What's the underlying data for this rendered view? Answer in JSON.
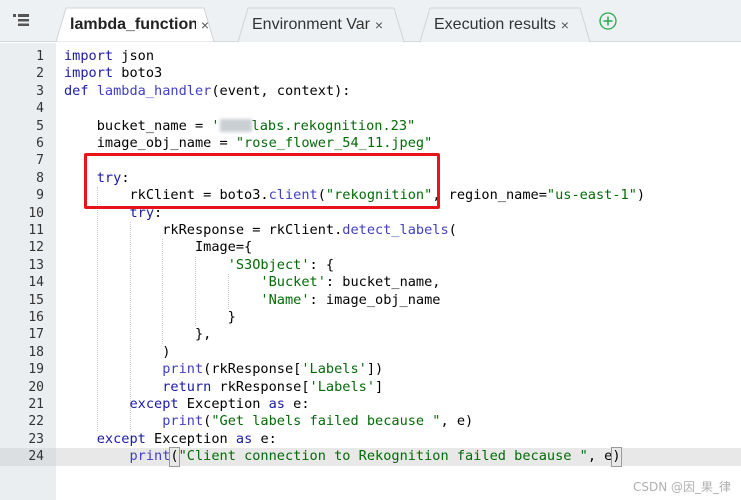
{
  "tabs": [
    {
      "label": "lambda_function",
      "close": "×",
      "active": true
    },
    {
      "label": "Environment Var",
      "close": "×",
      "active": false
    },
    {
      "label": "Execution results",
      "close": "×",
      "active": false
    }
  ],
  "icons": {
    "menu": "menu-icon",
    "add_tab": "plus-circle-icon",
    "accent": "#2aa84a",
    "highlight": "#e8141b"
  },
  "editor": {
    "line_numbers": [
      "1",
      "2",
      "3",
      "4",
      "5",
      "6",
      "7",
      "8",
      "9",
      "10",
      "11",
      "12",
      "13",
      "14",
      "15",
      "16",
      "17",
      "18",
      "19",
      "20",
      "21",
      "22",
      "23",
      "24"
    ],
    "current_line": 24,
    "lines": [
      [
        {
          "t": "import",
          "c": "kw"
        },
        {
          "t": " json",
          "c": "plain"
        }
      ],
      [
        {
          "t": "import",
          "c": "kw"
        },
        {
          "t": " boto3",
          "c": "plain"
        }
      ],
      [
        {
          "t": "def",
          "c": "kw"
        },
        {
          "t": " ",
          "c": "plain"
        },
        {
          "t": "lambda_handler",
          "c": "fn"
        },
        {
          "t": "(event, context):",
          "c": "plain"
        }
      ],
      [],
      [
        {
          "t": "    bucket_name = ",
          "c": "plain"
        },
        {
          "t": "'",
          "c": "str"
        },
        {
          "t": "",
          "c": "blur"
        },
        {
          "t": "labs.rekognition.23\"",
          "c": "str"
        }
      ],
      [
        {
          "t": "    image_obj_name = ",
          "c": "plain"
        },
        {
          "t": "\"rose_flower_54_11.jpeg\"",
          "c": "str"
        }
      ],
      [],
      [
        {
          "t": "    ",
          "c": "plain"
        },
        {
          "t": "try",
          "c": "kw"
        },
        {
          "t": ":",
          "c": "plain"
        }
      ],
      [
        {
          "t": "        rkClient = boto3.",
          "c": "plain"
        },
        {
          "t": "client",
          "c": "fn"
        },
        {
          "t": "(",
          "c": "plain"
        },
        {
          "t": "\"rekognition\"",
          "c": "str"
        },
        {
          "t": ", region_name=",
          "c": "plain"
        },
        {
          "t": "\"us-east-1\"",
          "c": "str"
        },
        {
          "t": ")",
          "c": "plain"
        }
      ],
      [
        {
          "t": "        ",
          "c": "plain"
        },
        {
          "t": "try",
          "c": "kw"
        },
        {
          "t": ":",
          "c": "plain"
        }
      ],
      [
        {
          "t": "            rkResponse = rkClient.",
          "c": "plain"
        },
        {
          "t": "detect_labels",
          "c": "fn"
        },
        {
          "t": "(",
          "c": "plain"
        }
      ],
      [
        {
          "t": "                Image={",
          "c": "plain"
        }
      ],
      [
        {
          "t": "                    ",
          "c": "plain"
        },
        {
          "t": "'S3Object'",
          "c": "str"
        },
        {
          "t": ": {",
          "c": "plain"
        }
      ],
      [
        {
          "t": "                        ",
          "c": "plain"
        },
        {
          "t": "'Bucket'",
          "c": "str"
        },
        {
          "t": ": bucket_name,",
          "c": "plain"
        }
      ],
      [
        {
          "t": "                        ",
          "c": "plain"
        },
        {
          "t": "'Name'",
          "c": "str"
        },
        {
          "t": ": image_obj_name",
          "c": "plain"
        }
      ],
      [
        {
          "t": "                    }",
          "c": "plain"
        }
      ],
      [
        {
          "t": "                },",
          "c": "plain"
        }
      ],
      [
        {
          "t": "            )",
          "c": "plain"
        }
      ],
      [
        {
          "t": "            ",
          "c": "plain"
        },
        {
          "t": "print",
          "c": "fn"
        },
        {
          "t": "(rkResponse[",
          "c": "plain"
        },
        {
          "t": "'Labels'",
          "c": "str"
        },
        {
          "t": "])",
          "c": "plain"
        }
      ],
      [
        {
          "t": "            ",
          "c": "plain"
        },
        {
          "t": "return",
          "c": "kw"
        },
        {
          "t": " rkResponse[",
          "c": "plain"
        },
        {
          "t": "'Labels'",
          "c": "str"
        },
        {
          "t": "]",
          "c": "plain"
        }
      ],
      [
        {
          "t": "        ",
          "c": "plain"
        },
        {
          "t": "except",
          "c": "kw"
        },
        {
          "t": " Exception ",
          "c": "plain"
        },
        {
          "t": "as",
          "c": "kw"
        },
        {
          "t": " e:",
          "c": "plain"
        }
      ],
      [
        {
          "t": "            ",
          "c": "plain"
        },
        {
          "t": "print",
          "c": "fn"
        },
        {
          "t": "(",
          "c": "plain"
        },
        {
          "t": "\"Get labels failed because \"",
          "c": "str"
        },
        {
          "t": ", e)",
          "c": "plain"
        }
      ],
      [
        {
          "t": "    ",
          "c": "plain"
        },
        {
          "t": "except",
          "c": "kw"
        },
        {
          "t": " Exception ",
          "c": "plain"
        },
        {
          "t": "as",
          "c": "kw"
        },
        {
          "t": " e:",
          "c": "plain"
        }
      ],
      [
        {
          "t": "        ",
          "c": "plain"
        },
        {
          "t": "print",
          "c": "fn"
        },
        {
          "t": "(",
          "c": "paren"
        },
        {
          "t": "\"Client connection to Rekognition failed because \"",
          "c": "str"
        },
        {
          "t": ", e",
          "c": "plain"
        },
        {
          "t": ")",
          "c": "paren"
        }
      ]
    ]
  },
  "watermark": "CSDN @因_果_律"
}
